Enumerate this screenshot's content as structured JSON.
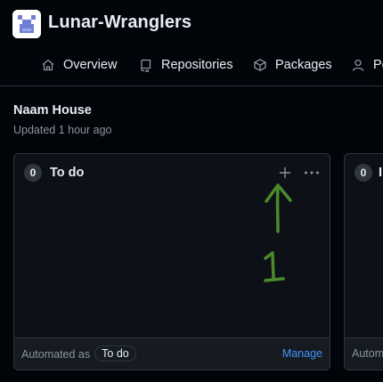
{
  "org": {
    "name": "Lunar-Wranglers",
    "avatar_icon": "organization-avatar"
  },
  "nav": {
    "items": [
      {
        "label": "Overview",
        "icon": "home-icon"
      },
      {
        "label": "Repositories",
        "icon": "repo-icon"
      },
      {
        "label": "Packages",
        "icon": "package-icon"
      },
      {
        "label": "Pe",
        "icon": "person-icon"
      }
    ]
  },
  "project": {
    "title": "Naam House",
    "updated": "Updated 1 hour ago"
  },
  "columns": [
    {
      "count": "0",
      "title": "To do",
      "footer": {
        "automated_label": "Automated as",
        "automation": "To do",
        "manage": "Manage"
      }
    },
    {
      "count": "0",
      "title": "I",
      "footer": {
        "automated_label": "Autom"
      }
    }
  ],
  "annotation": {
    "label": "1",
    "color": "#4a8a2a"
  },
  "colors": {
    "background": "#010409",
    "column_bg": "#0d1117",
    "border": "#30363d",
    "link": "#4493f8",
    "muted": "#8b949e"
  }
}
